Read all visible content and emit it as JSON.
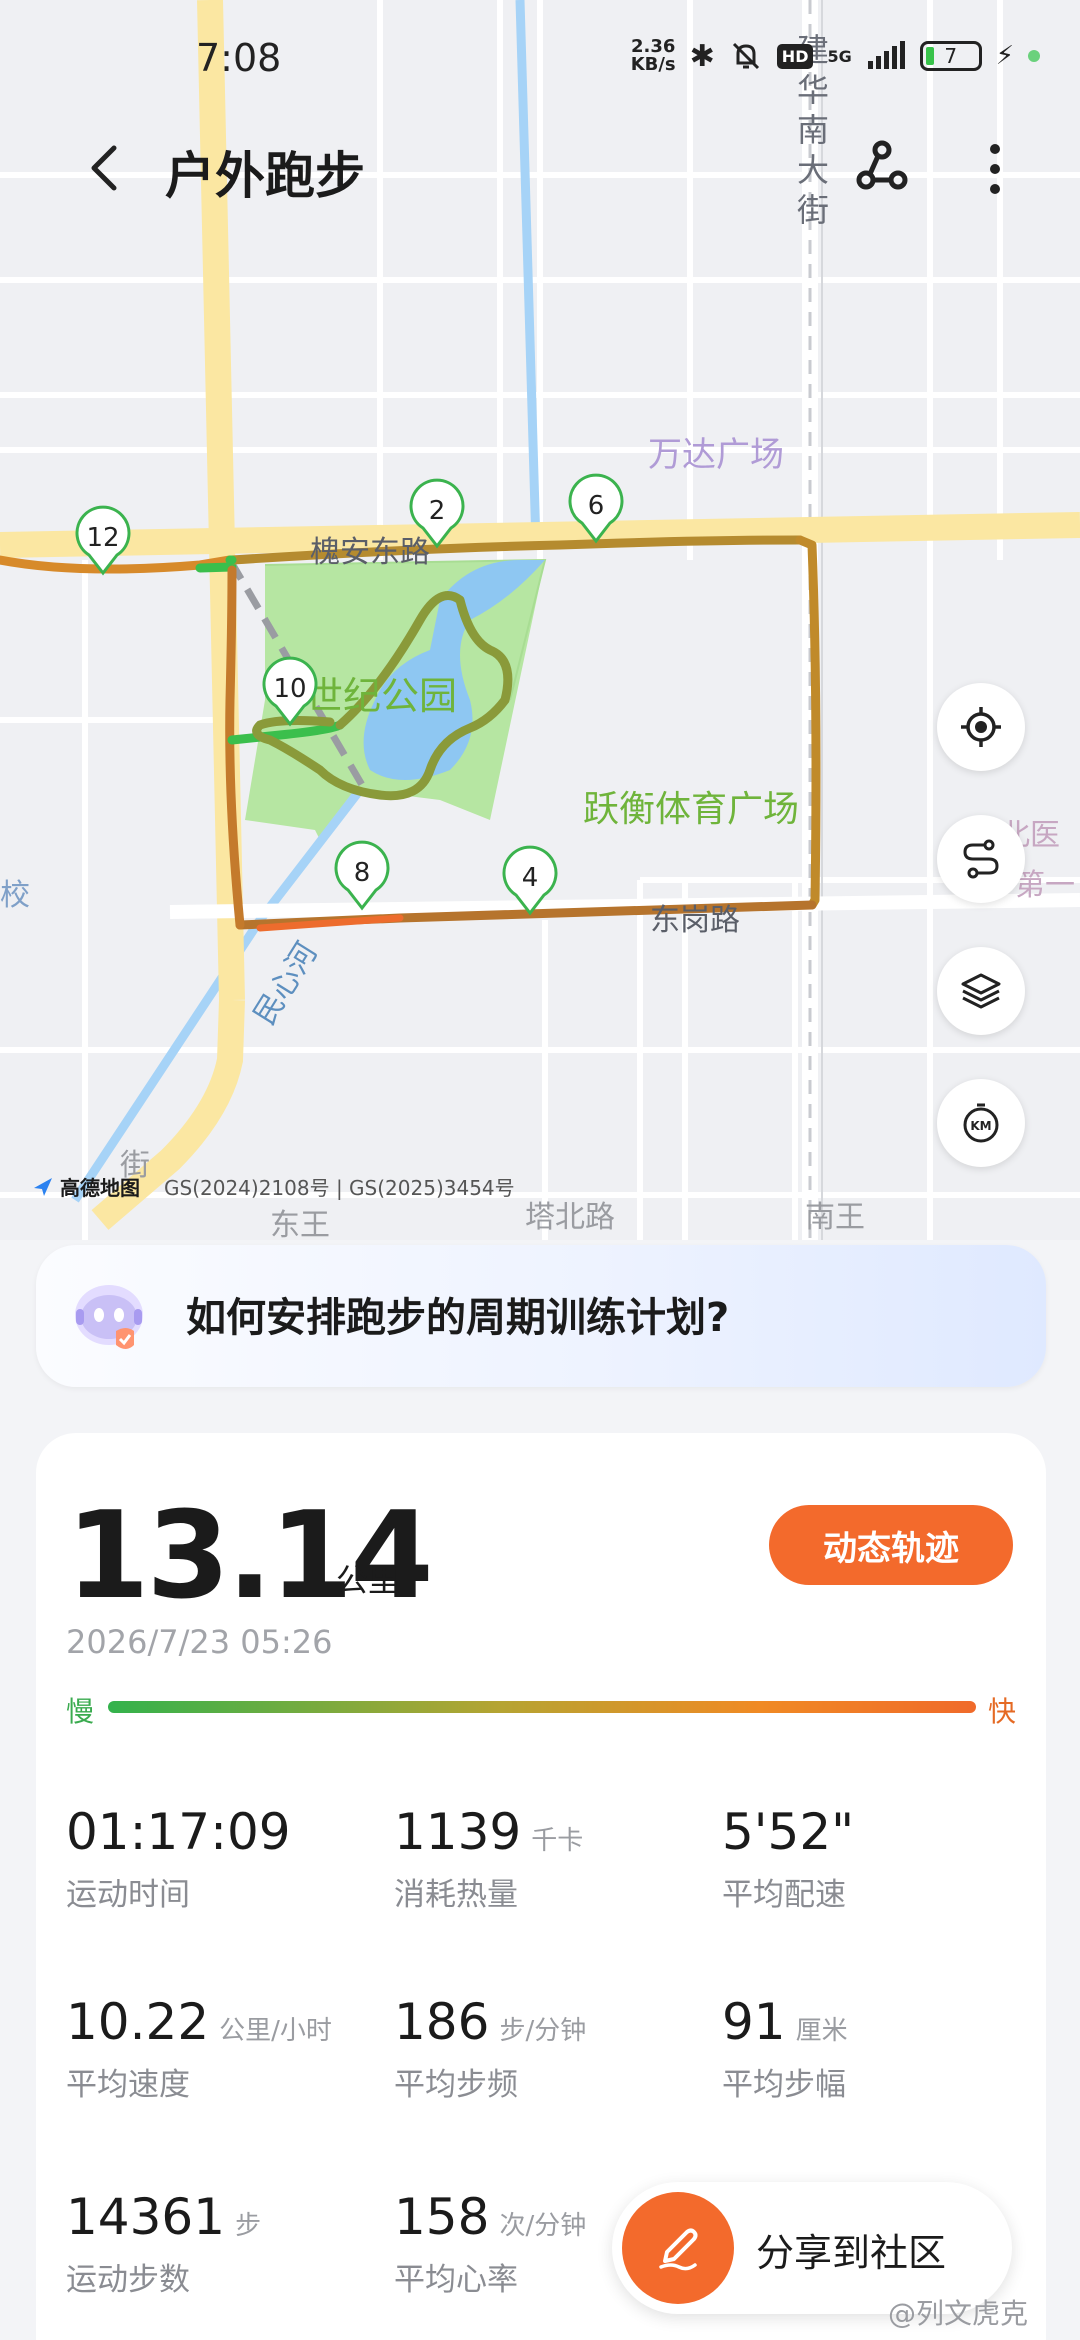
{
  "status_bar": {
    "time": "7:08",
    "net_speed": "2.36",
    "net_unit": "KB/s",
    "hd_badge": "HD",
    "signal_label": "5G",
    "battery": "7"
  },
  "header": {
    "title": "户外跑步",
    "back_icon": "chevron-left-icon",
    "route_icon": "route-share-icon",
    "more_icon": "more-vertical-icon"
  },
  "map": {
    "labels": {
      "park": "世纪公园",
      "sports_square": "跃衡体育广场",
      "wanda": "万达广场",
      "street_chars": [
        "建",
        "华",
        "南",
        "大",
        "街"
      ],
      "road_top_partial": "槐安东路",
      "road_bottom_partial": "东岗路",
      "river": "民心河",
      "road_bottom_left": "东王",
      "road_bottom": "塔北路",
      "road_bottom_right": "南王",
      "right_edge": "北医",
      "right_edge_2": "第一",
      "left_edge": "校",
      "left_edge_2": "街"
    },
    "km_markers": [
      "2",
      "4",
      "6",
      "8",
      "10",
      "12"
    ],
    "watermark_logo": "高德地图",
    "watermark_gs": "GS(2024)2108号 | GS(2025)3454号",
    "buttons": [
      "locate-icon",
      "route-toggle-icon",
      "layers-icon",
      "km-marker-icon"
    ],
    "km_button_label": "KM"
  },
  "prompt": {
    "text": "如何安排跑步的周期训练计划?"
  },
  "summary": {
    "distance": "13.14",
    "distance_unit": "公里",
    "button_label": "动态轨迹",
    "datetime": "2026/7/23 05:26",
    "slow_label": "慢",
    "fast_label": "快",
    "colors": {
      "accent": "#f36a2c",
      "slow": "#33b24c",
      "fast": "#f06a2a"
    }
  },
  "stats": [
    {
      "value": "01:17:09",
      "unit": "",
      "label": "运动时间"
    },
    {
      "value": "1139",
      "unit": "千卡",
      "label": "消耗热量"
    },
    {
      "value": "5'52\"",
      "unit": "",
      "label": "平均配速"
    },
    {
      "value": "10.22",
      "unit": "公里/小时",
      "label": "平均速度"
    },
    {
      "value": "186",
      "unit": "步/分钟",
      "label": "平均步频"
    },
    {
      "value": "91",
      "unit": "厘米",
      "label": "平均步幅"
    },
    {
      "value": "14361",
      "unit": "步",
      "label": "运动步数"
    },
    {
      "value": "158",
      "unit": "次/分钟",
      "label": "平均心率"
    }
  ],
  "share": {
    "label": "分享到社区",
    "icon": "pen-icon"
  },
  "watermark": "@列文虎克"
}
